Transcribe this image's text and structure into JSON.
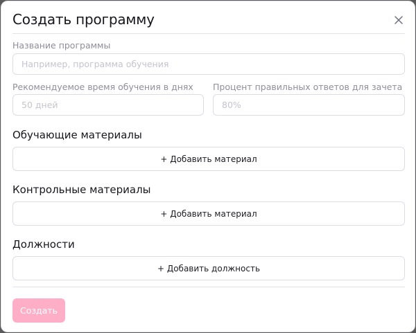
{
  "modal": {
    "title": "Создать программу",
    "close_icon": "close-icon"
  },
  "form": {
    "name": {
      "label": "Название программы",
      "placeholder": "Например, программа обучения",
      "value": ""
    },
    "days": {
      "label": "Рекомендуемое время обучения в днях",
      "placeholder": "50 дней",
      "value": ""
    },
    "percent": {
      "label": "Процент правильных ответов для зачета",
      "placeholder": "80%",
      "value": ""
    }
  },
  "sections": {
    "learning": {
      "title": "Обучающие материалы",
      "button_label": "+ Добавить материал"
    },
    "control": {
      "title": "Контрольные материалы",
      "button_label": "+ Добавить материал"
    },
    "positions": {
      "title": "Должности",
      "button_label": "+ Добавить должность"
    }
  },
  "footer": {
    "submit_label": "Создать"
  },
  "colors": {
    "accent_disabled": "#ffaec8",
    "border": "#dcdce6",
    "placeholder": "#c4c4ce",
    "label": "#8e8e9c"
  }
}
